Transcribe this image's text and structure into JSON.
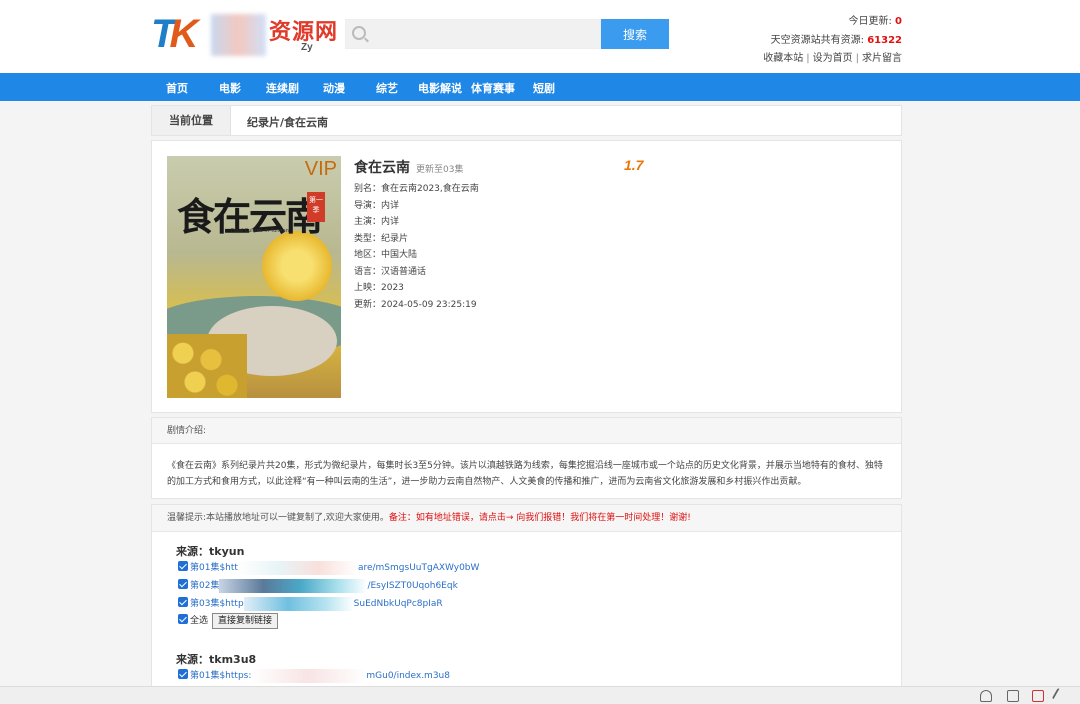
{
  "header": {
    "logo_name": "资源网",
    "logo_sub": "Zy",
    "search_placeholder": "",
    "search_button": "搜索",
    "today_update_label": "今日更新:",
    "today_update_value": "0",
    "total_label": "天空资源站共有资源:",
    "total_value": "61322",
    "links": [
      "收藏本站",
      "设为首页",
      "求片留言"
    ]
  },
  "nav": [
    "首页",
    "电影",
    "连续剧",
    "动漫",
    "综艺",
    "电影解说",
    "体育赛事",
    "短剧"
  ],
  "breadcrumb": {
    "label": "当前位置",
    "path": "纪录片/食在云南"
  },
  "detail": {
    "poster": {
      "title_art": "食在云南",
      "vip": "VIP",
      "badge": "第一季",
      "subtitle_en": "Food Culture In Yunnan"
    },
    "title": "食在云南",
    "status": "更新至03集",
    "score": "1.7",
    "rows": [
      "别名：食在云南2023,食在云南",
      "导演：内详",
      "主演：内详",
      "类型：纪录片",
      "地区：中国大陆",
      "语言：汉语普通话",
      "上映：2023",
      "更新：2024-05-09 23:25:19"
    ]
  },
  "intro": {
    "heading": "剧情介绍:",
    "text": "《食在云南》系列纪录片共20集，形式为微纪录片，每集时长3至5分钟。该片以滇越铁路为线索，每集挖掘沿线一座城市或一个站点的历史文化背景，并展示当地特有的食材、独特的加工方式和食用方式，以此诠释“有一种叫云南的生活”，进一步助力云南自然物产、人文美食的传播和推广，进而为云南省文化旅游发展和乡村振兴作出贡献。"
  },
  "sources": {
    "tip": "温馨提示:本站播放地址可以一键复制了,欢迎大家使用。",
    "warn": "备注：如有地址错误，请点击→ 向我们报错！我们将在第一时间处理！谢谢!",
    "groups": [
      {
        "title": "来源：tkyun",
        "episodes": [
          {
            "prefix": "第01集$htt",
            "suffix": "are/mSmgsUuTgAXWy0bW"
          },
          {
            "prefix": "第02集",
            "suffix": "/EsyISZT0Uqoh6Eqk"
          },
          {
            "prefix": "第03集$http",
            "suffix": "SuEdNbkUqPc8pIaR"
          }
        ],
        "select_all": "全选",
        "copy_button": "直接复制链接"
      },
      {
        "title": "来源：tkm3u8",
        "episodes": [
          {
            "prefix": "第01集$https:",
            "suffix": "mGu0/index.m3u8"
          }
        ]
      }
    ]
  }
}
